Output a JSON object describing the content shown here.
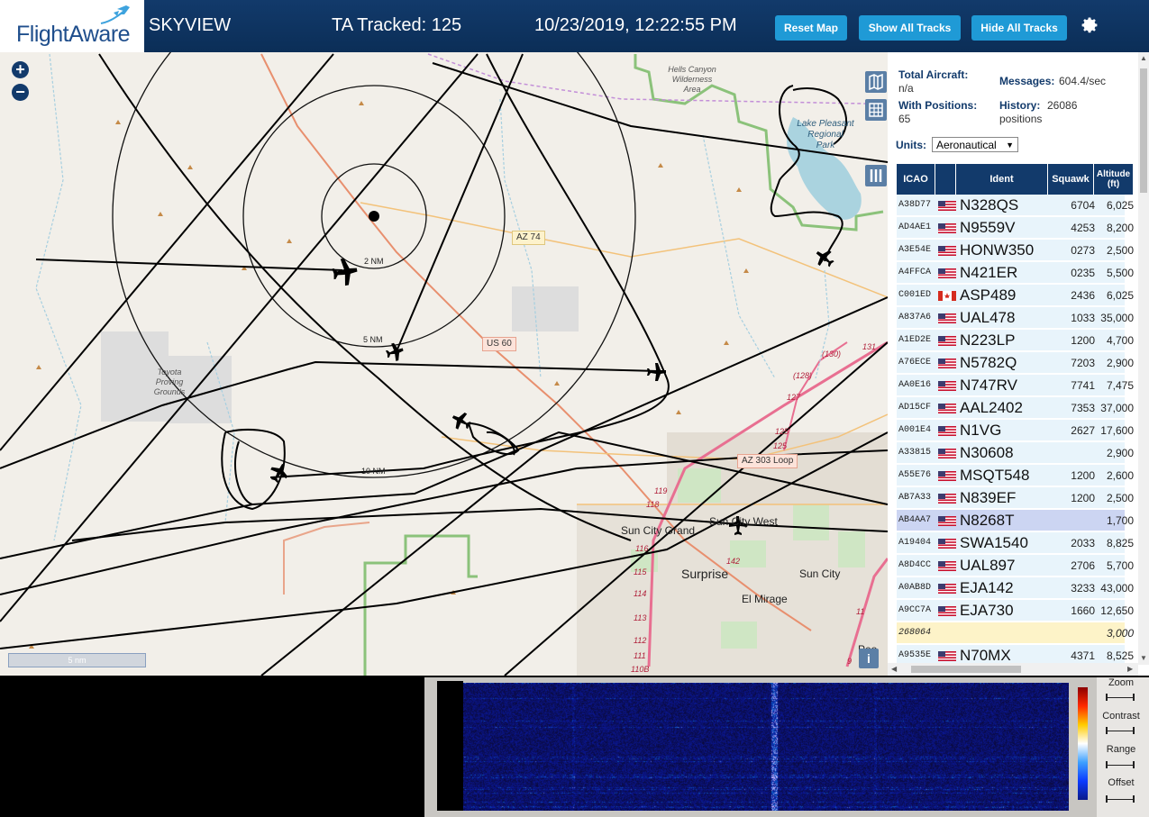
{
  "header": {
    "logo_text": "FlightAware",
    "app_name": "SKYVIEW",
    "tracked": "TA Tracked: 125",
    "datetime": "10/23/2019, 12:22:55 PM",
    "buttons": {
      "reset_map": "Reset Map",
      "show_all": "Show All Tracks",
      "hide_all": "Hide All Tracks"
    },
    "settings_icon": "gear-icon"
  },
  "map": {
    "zoom_in": "+",
    "zoom_out": "−",
    "scale": "5 nm",
    "info": "i",
    "range_rings": [
      "2 NM",
      "5 NM",
      "10 NM"
    ],
    "labels": {
      "hells_canyon": "Hells Canyon\nWilderness\nArea",
      "lake_pleasant": "Lake Pleasant\nRegional\nPark",
      "toyota": "Toyota\nProving\nGrounds",
      "sun_city_grand": "Sun City Grand",
      "sun_city_west": "Sun City West",
      "surprise": "Surprise",
      "sun_city": "Sun City",
      "el_mirage": "El Mirage",
      "peoria": "Peo"
    },
    "road_shields": {
      "az74": "AZ 74",
      "us60": "US 60",
      "az303": "AZ 303 Loop"
    },
    "road_numbers": [
      "131",
      "(130)",
      "(128)",
      "127",
      "125",
      "125",
      "119",
      "118",
      "116",
      "115",
      "114",
      "113",
      "112",
      "111",
      "110B",
      "142",
      "11",
      "9"
    ]
  },
  "panel": {
    "total_aircraft_label": "Total Aircraft:",
    "total_aircraft_value": "n/a",
    "messages_label": "Messages:",
    "messages_value": "604.4/sec",
    "with_positions_label": "With Positions:",
    "with_positions_value": "65",
    "history_label": "History:",
    "history_value": "26086",
    "history_unit": "positions",
    "units_label": "Units:",
    "units_value": "Aeronautical",
    "columns": [
      "ICAO",
      "",
      "Ident",
      "Squawk",
      "Altitude (ft)"
    ],
    "rows": [
      {
        "icao": "A38D77",
        "flag": "us",
        "ident": "N328QS",
        "squawk": "6704",
        "alt": "6,025"
      },
      {
        "icao": "AD4AE1",
        "flag": "us",
        "ident": "N9559V",
        "squawk": "4253",
        "alt": "8,200"
      },
      {
        "icao": "A3E54E",
        "flag": "us",
        "ident": "HONW350",
        "squawk": "0273",
        "alt": "2,500"
      },
      {
        "icao": "A4FFCA",
        "flag": "us",
        "ident": "N421ER",
        "squawk": "0235",
        "alt": "5,500"
      },
      {
        "icao": "C001ED",
        "flag": "ca",
        "ident": "ASP489",
        "squawk": "2436",
        "alt": "6,025"
      },
      {
        "icao": "A837A6",
        "flag": "us",
        "ident": "UAL478",
        "squawk": "1033",
        "alt": "35,000"
      },
      {
        "icao": "A1ED2E",
        "flag": "us",
        "ident": "N223LP",
        "squawk": "1200",
        "alt": "4,700"
      },
      {
        "icao": "A76ECE",
        "flag": "us",
        "ident": "N5782Q",
        "squawk": "7203",
        "alt": "2,900"
      },
      {
        "icao": "AA0E16",
        "flag": "us",
        "ident": "N747RV",
        "squawk": "7741",
        "alt": "7,475"
      },
      {
        "icao": "AD15CF",
        "flag": "us",
        "ident": "AAL2402",
        "squawk": "7353",
        "alt": "37,000"
      },
      {
        "icao": "A001E4",
        "flag": "us",
        "ident": "N1VG",
        "squawk": "2627",
        "alt": "17,600"
      },
      {
        "icao": "A33815",
        "flag": "us",
        "ident": "N30608",
        "squawk": "",
        "alt": "2,900"
      },
      {
        "icao": "A55E76",
        "flag": "us",
        "ident": "MSQT548",
        "squawk": "1200",
        "alt": "2,600"
      },
      {
        "icao": "AB7A33",
        "flag": "us",
        "ident": "N839EF",
        "squawk": "1200",
        "alt": "2,500"
      },
      {
        "icao": "AB4AA7",
        "flag": "us",
        "ident": "N8268T",
        "squawk": "",
        "alt": "1,700",
        "selected": true
      },
      {
        "icao": "A19404",
        "flag": "us",
        "ident": "SWA1540",
        "squawk": "2033",
        "alt": "8,825"
      },
      {
        "icao": "A8D4CC",
        "flag": "us",
        "ident": "UAL897",
        "squawk": "2706",
        "alt": "5,700"
      },
      {
        "icao": "A0AB8D",
        "flag": "us",
        "ident": "EJA142",
        "squawk": "3233",
        "alt": "43,000"
      },
      {
        "icao": "A9CC7A",
        "flag": "us",
        "ident": "EJA730",
        "squawk": "1660",
        "alt": "12,650"
      },
      {
        "icao": "268064",
        "flag": "",
        "ident": "",
        "squawk": "",
        "alt": "3,000",
        "noid": true
      },
      {
        "icao": "A9535E",
        "flag": "us",
        "ident": "N70MX",
        "squawk": "4371",
        "alt": "8,525"
      }
    ]
  },
  "waterfall": {
    "controls": [
      "Zoom",
      "Contrast",
      "Range",
      "Offset"
    ]
  },
  "colors": {
    "header_bg": "#0b2e57",
    "button_bg": "#1f9ad6",
    "table_header": "#123a6b",
    "row_bg": "#e8f4fb",
    "row_selected": "#ccd5f2",
    "row_noid": "#fdf3c8"
  }
}
